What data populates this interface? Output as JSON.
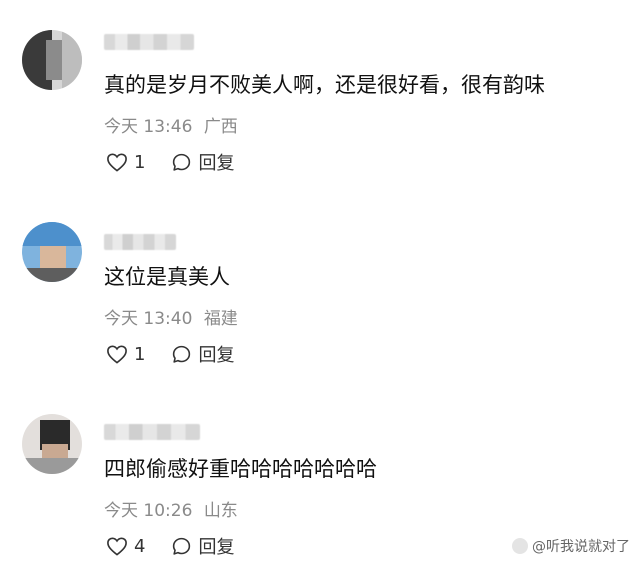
{
  "comments": [
    {
      "text": "真的是岁月不败美人啊，还是很好看，很有韵味",
      "time": "今天 13:46",
      "location": "广西",
      "likes": "1",
      "reply_label": "回复"
    },
    {
      "text": "这位是真美人",
      "time": "今天 13:40",
      "location": "福建",
      "likes": "1",
      "reply_label": "回复"
    },
    {
      "text": "四郎偷感好重哈哈哈哈哈哈哈",
      "time": "今天 10:26",
      "location": "山东",
      "likes": "4",
      "reply_label": "回复"
    }
  ],
  "watermark": "@听我说就对了",
  "icons": {
    "like": "heart-outline-icon",
    "reply": "speech-bubble-icon"
  },
  "colors": {
    "meta": "#8a8a8a",
    "text": "#111111",
    "action": "#333333"
  }
}
